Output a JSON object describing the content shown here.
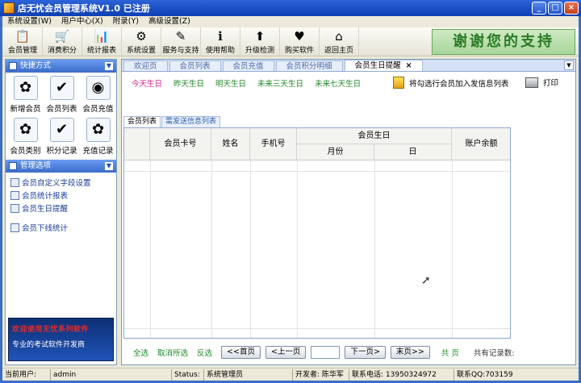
{
  "window": {
    "title": "店无忧会员管理系统V1.0 已注册",
    "min": "_",
    "max": "□",
    "close": "×"
  },
  "menu": [
    "系统设置(W)",
    "用户中心(X)",
    "附录(Y)",
    "高级设置(Z)"
  ],
  "toolbar": {
    "items": [
      {
        "label": "会员管理",
        "icon": "📋",
        "name": "member-manage"
      },
      {
        "label": "消费积分",
        "icon": "🛒",
        "name": "consume-points"
      },
      {
        "label": "统计报表",
        "icon": "📊",
        "name": "stats-report"
      },
      {
        "label": "系统设置",
        "icon": "⚙",
        "name": "system-settings"
      },
      {
        "label": "服务与支持",
        "icon": "✎",
        "name": "service-support"
      },
      {
        "label": "使用帮助",
        "icon": "ℹ",
        "name": "help"
      },
      {
        "label": "升级检测",
        "icon": "⬆",
        "name": "upgrade-check"
      },
      {
        "label": "购买软件",
        "icon": "♥",
        "name": "buy-software"
      },
      {
        "label": "返回主页",
        "icon": "⌂",
        "name": "home"
      }
    ],
    "thanks": "谢谢您的支持"
  },
  "sidebar": {
    "quick_title": "快捷方式",
    "quick": [
      {
        "label": "新增会员",
        "icon": "✿",
        "name": "add-member"
      },
      {
        "label": "会员列表",
        "icon": "✔",
        "name": "member-list"
      },
      {
        "label": "会员充值",
        "icon": "◉",
        "name": "member-recharge"
      },
      {
        "label": "会员类别",
        "icon": "✿",
        "name": "member-category"
      },
      {
        "label": "积分记录",
        "icon": "✔",
        "name": "points-record"
      },
      {
        "label": "充值记录",
        "icon": "✿",
        "name": "recharge-record"
      }
    ],
    "mgmt_title": "管理选项",
    "mgmt": [
      {
        "label": "会员自定义字段设置",
        "name": "custom-fields"
      },
      {
        "label": "会员统计报表",
        "name": "member-stats"
      },
      {
        "label": "会员生日提醒",
        "name": "birthday-reminder"
      },
      {
        "label": "会员下线统计",
        "name": "downline-stats"
      }
    ],
    "ad_top": "欢迎使用无忧系列软件",
    "ad_bottom": "专业的考试软件开发商"
  },
  "tabs": [
    {
      "label": "欢迎页",
      "active": false
    },
    {
      "label": "会员列表",
      "active": false
    },
    {
      "label": "会员充值",
      "active": false
    },
    {
      "label": "会员积分明细",
      "active": false
    },
    {
      "label": "会员生日提醒",
      "active": true,
      "close": "×"
    }
  ],
  "filters": [
    "今天生日",
    "昨天生日",
    "明天生日",
    "未来三天生日",
    "未来七天生日"
  ],
  "actions": {
    "add_sms": "将勾选行会员加入发信息列表",
    "print": "打印"
  },
  "subtabs": [
    "会员列表",
    "需发送信息列表"
  ],
  "grid": {
    "headers": {
      "card": "会员卡号",
      "name": "姓名",
      "phone": "手机号",
      "birthday": "会员生日",
      "month": "月份",
      "day": "日",
      "balance": "账户余额"
    }
  },
  "pager": {
    "select_all": "全选",
    "deselect": "取消所选",
    "invert": "反选",
    "first": "<<首页",
    "prev": "<上一页",
    "next": "下一页>",
    "last": "末页>>",
    "total_pages": "共   页",
    "total_records": "共有记录数:"
  },
  "status": {
    "user_label": "当前用户:",
    "user": "admin",
    "status_label": "Status:",
    "status": "系统管理员",
    "developer": "开发者: 陈华军",
    "phone": "联系电话: 13950324972",
    "qq": "联系QQ:703159"
  }
}
